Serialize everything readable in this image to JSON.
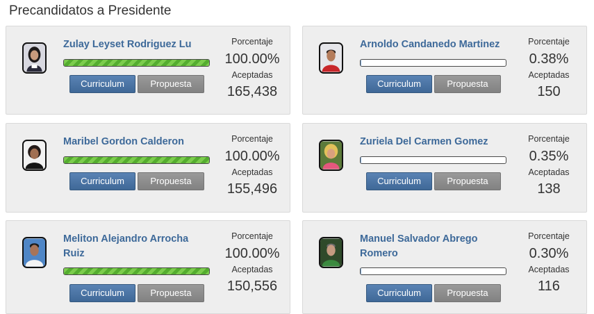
{
  "page": {
    "title": "Precandidatos a Presidente"
  },
  "labels": {
    "percent": "Porcentaje",
    "accepted": "Aceptadas",
    "curriculum": "Curriculum",
    "proposal": "Propuesta"
  },
  "candidates": [
    {
      "name": "Zulay Leyset Rodriguez Lu",
      "percent_text": "100.00%",
      "percent": 100.0,
      "accepted": "165,438"
    },
    {
      "name": "Arnoldo Candanedo Martinez",
      "percent_text": "0.38%",
      "percent": 0.38,
      "accepted": "150"
    },
    {
      "name": "Maribel Gordon Calderon",
      "percent_text": "100.00%",
      "percent": 100.0,
      "accepted": "155,496"
    },
    {
      "name": "Zuriela Del Carmen Gomez",
      "percent_text": "0.35%",
      "percent": 0.35,
      "accepted": "138"
    },
    {
      "name": "Meliton Alejandro Arrocha Ruiz",
      "percent_text": "100.00%",
      "percent": 100.0,
      "accepted": "150,556"
    },
    {
      "name": "Manuel Salvador Abrego Romero",
      "percent_text": "0.30%",
      "percent": 0.3,
      "accepted": "116"
    }
  ],
  "colors": {
    "name": "#3d6999",
    "progress_green": "#6cc140",
    "curriculum_button": "#4a74a6",
    "proposal_button": "#8c8c8c"
  }
}
